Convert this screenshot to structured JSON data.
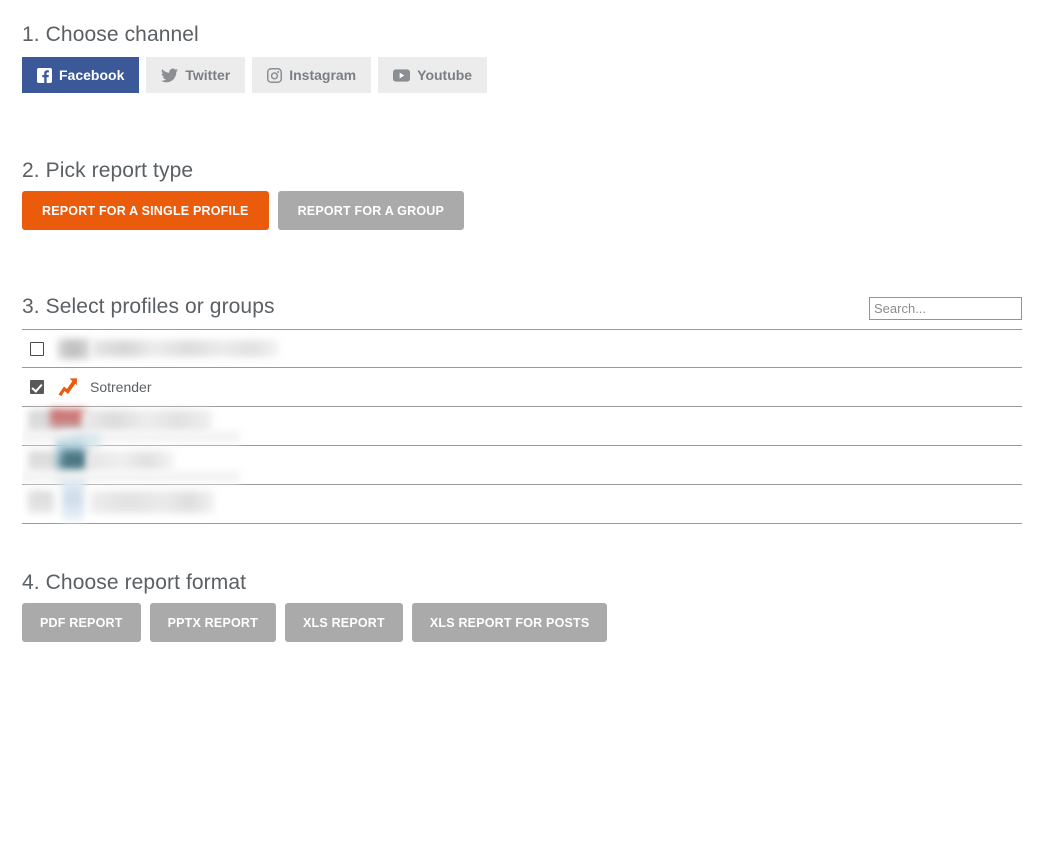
{
  "sections": {
    "channel": {
      "title": "1. Choose channel"
    },
    "report_type": {
      "title": "2. Pick report type"
    },
    "profiles": {
      "title": "3. Select profiles or groups"
    },
    "format": {
      "title": "4. Choose report format"
    }
  },
  "channels": [
    {
      "label": "Facebook",
      "icon": "facebook-icon",
      "active": true
    },
    {
      "label": "Twitter",
      "icon": "twitter-icon",
      "active": false
    },
    {
      "label": "Instagram",
      "icon": "instagram-icon",
      "active": false
    },
    {
      "label": "Youtube",
      "icon": "youtube-icon",
      "active": false
    }
  ],
  "report_types": [
    {
      "label": "REPORT FOR A SINGLE PROFILE",
      "selected": true
    },
    {
      "label": "REPORT FOR A GROUP",
      "selected": false
    }
  ],
  "search": {
    "placeholder": "Search...",
    "value": ""
  },
  "profile_rows": [
    {
      "checked": false,
      "label": "",
      "redacted": true,
      "icon": ""
    },
    {
      "checked": true,
      "label": "Sotrender",
      "redacted": false,
      "icon": "sotrender-logo-icon"
    },
    {
      "checked": false,
      "label": "",
      "redacted": true,
      "icon": ""
    },
    {
      "checked": false,
      "label": "",
      "redacted": true,
      "icon": ""
    },
    {
      "checked": false,
      "label": "",
      "redacted": true,
      "icon": ""
    }
  ],
  "formats": [
    {
      "label": "PDF REPORT"
    },
    {
      "label": "PPTX REPORT"
    },
    {
      "label": "XLS REPORT"
    },
    {
      "label": "XLS REPORT FOR POSTS"
    }
  ],
  "colors": {
    "facebook_blue": "#3b5998",
    "accent_orange": "#ea5b0c",
    "muted_gray": "#aaaaaa",
    "inactive_tab": "#ececec",
    "heading_text": "#5b6064"
  }
}
